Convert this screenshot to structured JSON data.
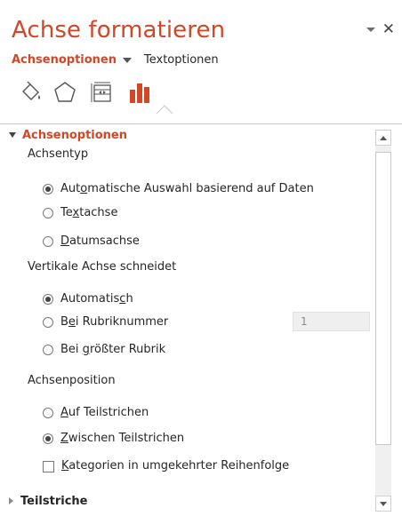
{
  "pane": {
    "title": "Achse formatieren",
    "accent_color": "#d24726",
    "tabs": {
      "active": "Achsenoptionen",
      "inactive": "Textoptionen"
    },
    "icons": [
      "fill-line-icon",
      "effects-pentagon-icon",
      "size-properties-icon",
      "axis-options-bar-chart-icon"
    ]
  },
  "sections": {
    "axis_options": {
      "header": "Achsenoptionen",
      "axis_type": {
        "label": "Achsentyp",
        "options": [
          {
            "text_a": "Aut",
            "ul": "o",
            "text_b": "matische Auswahl basierend auf Daten",
            "selected": true
          },
          {
            "text_a": "Te",
            "ul": "x",
            "text_b": "tachse",
            "selected": false
          },
          {
            "text_a": "",
            "ul": "D",
            "text_b": "atumsachse",
            "selected": false
          }
        ]
      },
      "vertical_axis_crosses": {
        "label": "Vertikale Achse schneidet",
        "options": [
          {
            "text_a": "Automatis",
            "ul": "c",
            "text_b": "h",
            "selected": true
          },
          {
            "text_a": "B",
            "ul": "e",
            "text_b": "i Rubriknummer",
            "selected": false,
            "value": "1"
          },
          {
            "text_a": "Bei ",
            "ul": "g",
            "text_b": "rößter Rubrik",
            "selected": false
          }
        ]
      },
      "axis_position": {
        "label": "Achsenposition",
        "options": [
          {
            "text_a": "",
            "ul": "A",
            "text_b": "uf Teilstrichen",
            "selected": false
          },
          {
            "text_a": "",
            "ul": "Z",
            "text_b": "wischen Teilstrichen",
            "selected": true
          }
        ]
      },
      "reverse_order": {
        "text_a": "",
        "ul": "K",
        "text_b": "ategorien in umgekehrter Reihenfolge",
        "checked": false
      }
    },
    "tick_marks": {
      "header": "Teilstriche"
    }
  }
}
